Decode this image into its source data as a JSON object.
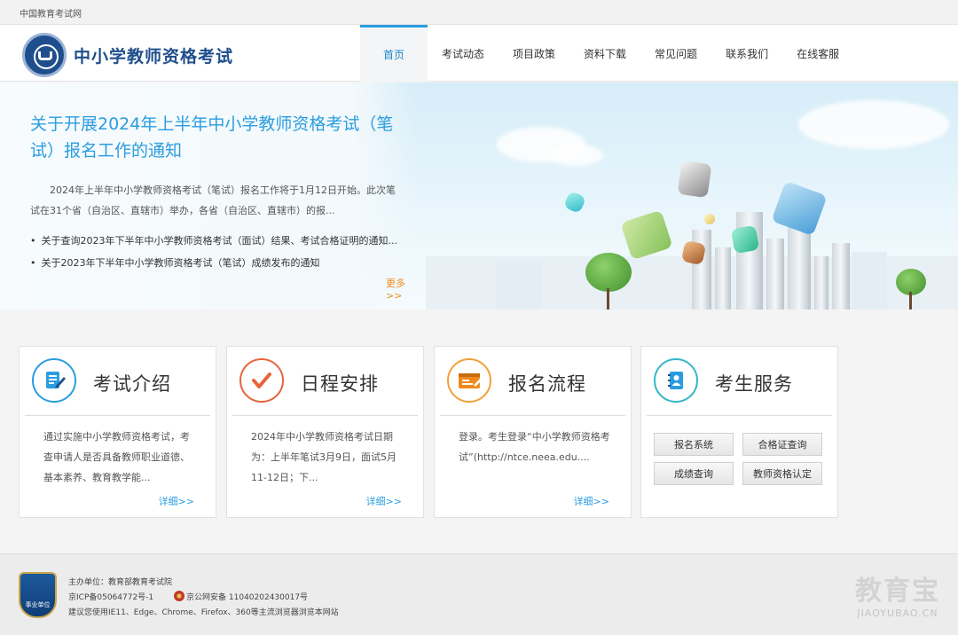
{
  "topbar": {
    "site_name": "中国教育考试网"
  },
  "header": {
    "title": "中小学教师资格考试",
    "nav": [
      "首页",
      "考试动态",
      "项目政策",
      "资料下载",
      "常见问题",
      "联系我们",
      "在线客服"
    ]
  },
  "banner": {
    "title": "关于开展2024年上半年中小学教师资格考试（笔试）报名工作的通知",
    "summary": "2024年上半年中小学教师资格考试（笔试）报名工作将于1月12日开始。此次笔试在31个省（自治区、直辖市）举办，各省（自治区、直辖市）的报...",
    "links": [
      "关于查询2023年下半年中小学教师资格考试（面试）结果、考试合格证明的通知...",
      "关于2023年下半年中小学教师资格考试（笔试）成绩发布的通知"
    ],
    "more": "更多>>"
  },
  "cards": [
    {
      "title": "考试介绍",
      "desc": "通过实施中小学教师资格考试，考查申请人是否具备教师职业道德、基本素养、教育教学能...",
      "more": "详细>>",
      "icon": "document-edit-icon"
    },
    {
      "title": "日程安排",
      "desc": "2024年中小学教师资格考试日期为：上半年笔试3月9日，面试5月11-12日；下...",
      "more": "详细>>",
      "icon": "checkmark-icon"
    },
    {
      "title": "报名流程",
      "desc": "登录。考生登录“中小学教师资格考试”(http://ntce.neea.edu....",
      "more": "详细>>",
      "icon": "registration-form-icon"
    },
    {
      "title": "考生服务",
      "buttons": [
        "报名系统",
        "合格证查询",
        "成绩查询",
        "教师资格认定"
      ],
      "icon": "contact-book-icon"
    }
  ],
  "footer": {
    "badge": "事业单位",
    "host": "主办单位：教育部教育考试院",
    "icp": "京ICP备05064772号-1",
    "police": "京公网安备 11040202430017号",
    "browser": "建议您使用IE11、Edge、Chrome、Firefox、360等主流浏览器浏览本网站"
  },
  "watermark": {
    "cn": "教育宝",
    "en": "JIAOYUBAO.CN"
  },
  "colors": {
    "primary": "#2a9de0",
    "brand_dark": "#1f4e8c",
    "accent_orange": "#f08a1d",
    "icon_red": "#e8633c"
  }
}
